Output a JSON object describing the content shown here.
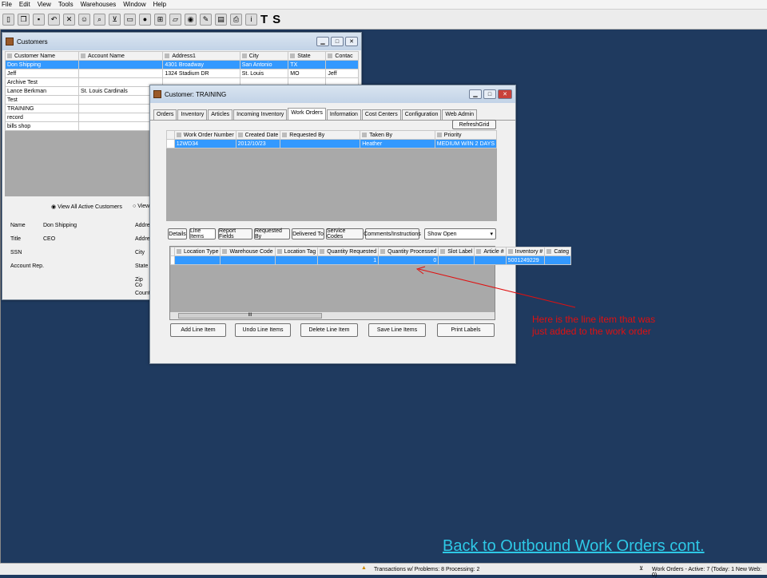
{
  "menu": [
    "File",
    "Edit",
    "View",
    "Tools",
    "Warehouses",
    "Window",
    "Help"
  ],
  "toolbar": {
    "letters": [
      "T",
      "S"
    ]
  },
  "customers_window": {
    "title": "Customers",
    "columns": [
      "Customer Name",
      "Account Name",
      "Address1",
      "City",
      "State",
      "Contac"
    ],
    "rows": [
      [
        "Don Shipping",
        "",
        "4301 Broadway",
        "San Antonio",
        "TX",
        ""
      ],
      [
        "Jeff",
        "",
        "1324 Stadium DR",
        "St. Louis",
        "MO",
        "Jeff"
      ],
      [
        "Archive Test",
        "",
        "",
        "",
        "",
        ""
      ],
      [
        "Lance Berkman",
        "St. Louis Cardinals",
        "",
        "",
        "",
        ""
      ],
      [
        "Test",
        "",
        "",
        "",
        "",
        ""
      ],
      [
        "TRAINING",
        "",
        "",
        "",
        "",
        ""
      ],
      [
        "record",
        "",
        "",
        "",
        "",
        ""
      ],
      [
        "bills shop",
        "",
        "",
        "",
        "",
        ""
      ]
    ],
    "radio_all": "View All Active Customers",
    "radio_other": "View",
    "details": {
      "name_label": "Name",
      "name_value": "Don Shipping",
      "title_label": "Title",
      "title_value": "CEO",
      "ssn_label": "SSN",
      "acct_label": "Account Rep.",
      "right_labels": [
        "Addres",
        "Addres",
        "City",
        "State",
        "Zip Co",
        "Countr"
      ]
    }
  },
  "training_window": {
    "title": "Customer: TRAINING",
    "tabs": [
      "Orders",
      "Inventory",
      "Articles",
      "Incoming Inventory",
      "Work Orders",
      "Information",
      "Cost Centers",
      "Configuration",
      "Web Admin"
    ],
    "refresh_label": "RefreshGrid",
    "wo_columns": [
      "Work Order Number",
      "Created Date",
      "Requested By",
      "Taken By",
      "Priority"
    ],
    "wo_rows": [
      [
        "12WD34",
        "2012/10/23",
        "",
        "Heather",
        "MEDIUM W/IN 2 DAYS"
      ]
    ],
    "sub_tabs": [
      "Details",
      "Line Items",
      "Report Fields",
      "Requested By",
      "Delivered To",
      "Service Codes",
      "Comments/Instructions"
    ],
    "show_select": "Show Open",
    "li_columns": [
      "Location Type",
      "Warehouse Code",
      "Location Tag",
      "Quantity Requested",
      "Quantity Processed",
      "Slot Label",
      "Article #",
      "Inventory #",
      "Categ"
    ],
    "li_rows": [
      [
        "",
        "",
        "",
        "1",
        "0",
        "",
        "",
        "5001249229",
        ""
      ]
    ],
    "scroll_label": "III",
    "buttons": [
      "Add Line Item",
      "Undo Line Items",
      "Delete Line Item",
      "Save Line Items",
      "Print Labels"
    ]
  },
  "annotation": "Here is the line item that was just added to the work order",
  "back_link": "Back to Outbound Work Orders cont.",
  "status": {
    "left": "Transactions w/ Problems: 8 Processing: 2",
    "right": "Work Orders - Active: 7 (Today: 1 New Web: 0)"
  },
  "colors": {
    "desktop": "#1f3a5f",
    "selection": "#3399ff",
    "annotation": "#e01010",
    "link": "#2ec8e6"
  }
}
